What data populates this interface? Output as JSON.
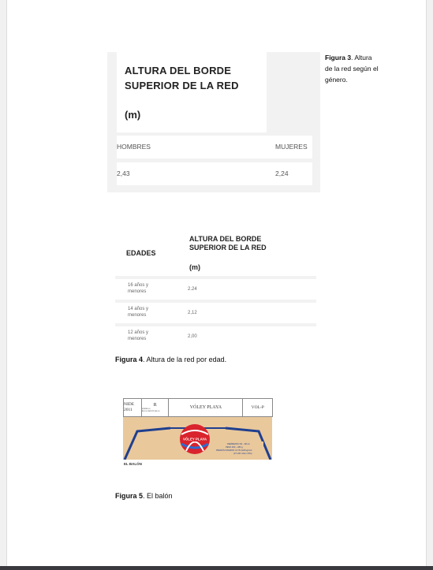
{
  "figure3": {
    "caption_bold": "Figura 3",
    "caption_rest": ". Altura de la red según el género.",
    "table": {
      "heading": "ALTURA DEL BORDE SUPERIOR DE LA RED",
      "unit": "(m)",
      "columns": [
        "HOMBRES",
        "MUJERES"
      ],
      "values": [
        "2,43",
        "2,24"
      ]
    }
  },
  "figure4": {
    "caption_bold": "Figura 4",
    "caption_rest": ". Altura de la red por edad.",
    "table": {
      "col1": "EDADES",
      "col2": "ALTURA DEL BORDE SUPERIOR DE LA RED",
      "unit": "(m)",
      "rows": [
        {
          "age": "16 años y menores",
          "value": "2.24"
        },
        {
          "age": "14 años y menores",
          "value": "2,12"
        },
        {
          "age": "12 años y menores",
          "value": "2,00"
        }
      ]
    }
  },
  "figure5": {
    "caption_bold": "Figura 5",
    "caption_rest": ". El balón",
    "doc_table": [
      "NIDE 2011",
      "R",
      "NORMAS REGLAMENTARIAS",
      "VÓLEY PLAYA",
      "VOL-P"
    ],
    "ball_text": "VÓLEY PLAYA",
    "ball_specs": [
      "PERÍMETRO 66 – 68 cm",
      "PESO 260 – 280 g",
      "PRESIÓN INTERIOR: 0,175-0,225 kg/cm2",
      "(171-221 mbar o hPa)"
    ],
    "label": "EL BALÓN"
  },
  "colors": {
    "page": "#ffffff",
    "background": "#f1f1f1",
    "sand": "#e9c89c",
    "court_line": "#1f3f8f",
    "ball_red": "#d9232d"
  }
}
